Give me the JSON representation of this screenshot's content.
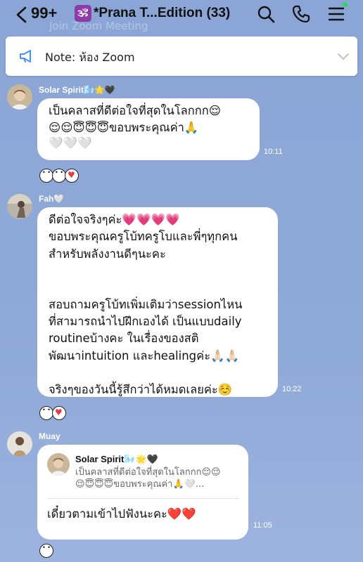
{
  "header": {
    "unread_count": "99+",
    "room_icon": "🕉",
    "room_title": "*Prana T...Edition (33)",
    "ghost_text": "Join Zoom Meeting"
  },
  "note": {
    "text": "Note: ห้อง Zoom"
  },
  "messages": [
    {
      "sender": "Solar Spirit🌬️🌟🖤",
      "lines": [
        "เป็นคลาสที่ดีต่อใจที่สุดในโลกกก😌",
        "😌😌😇😇😇ขอบพระคุณค่า🙏",
        "🤍🤍🤍"
      ],
      "time": "10:11"
    },
    {
      "sender": "Fah🤍",
      "lines": [
        "ดีต่อใจจริงๆค่ะ💗💗💗💗",
        "ขอบพระคุณครูโบ้ทครูโบและพี่ๆทุกคน",
        "สำหรับพลังงานดีๆนะคะ",
        "",
        "",
        "สอบถามครูโบ้ทเพิ่มเติมว่าsessionไหน",
        "ที่สามารถนำไปฝึกเองได้ เป็นแบบdaily",
        "routineบ้างคะ ในเรื่องของสติ",
        "พัฒนาintuition และhealingค่ะ🙏🏻🙏🏻",
        "",
        "จริงๆของวันนี้รู้สึกว่าได้หมดเลยค่ะ☺️"
      ],
      "time": "10:22"
    },
    {
      "sender": "Muay",
      "quote_name": "Solar Spirit🌬️🌟🖤",
      "quote_lines": [
        "เป็นคลาสที่ดีต่อใจที่สุดในโลกกก😌😌",
        "😌😇😇😇ขอบพระคุณค่า🙏🤍..."
      ],
      "reply": "เดี๋ยวตามเข้าไปฟังนะคะ❤️❤️",
      "time": "11:05"
    }
  ]
}
